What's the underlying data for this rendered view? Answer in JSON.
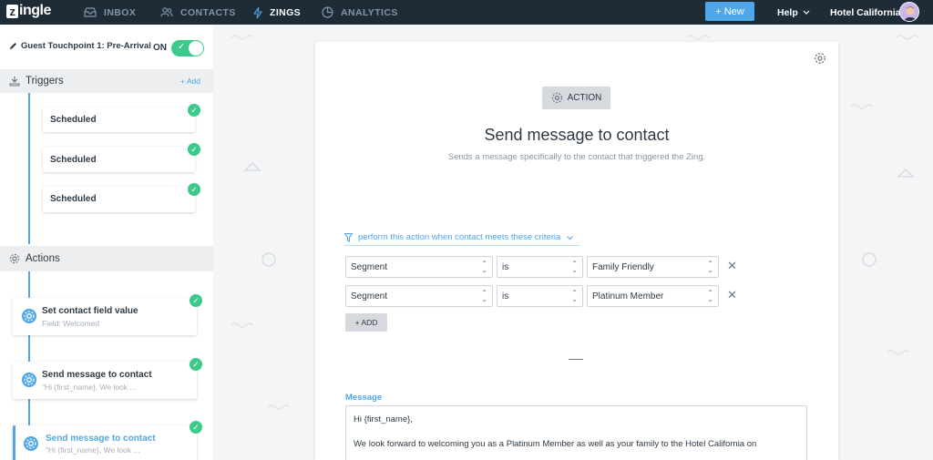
{
  "nav": {
    "logo": "ingle",
    "logo_mark": "z",
    "items": [
      {
        "label": "INBOX",
        "icon": "inbox-icon"
      },
      {
        "label": "CONTACTS",
        "icon": "contacts-icon"
      },
      {
        "label": "ZINGS",
        "icon": "lightning-icon"
      },
      {
        "label": "ANALYTICS",
        "icon": "pie-chart-icon"
      }
    ],
    "new_button": "+ New",
    "help": "Help",
    "account": "Hotel California"
  },
  "sidebar": {
    "zing_name": "Guest Touchpoint 1: Pre-Arrival",
    "toggle_label": "ON",
    "triggers": {
      "title": "Triggers",
      "add_label": "+ Add",
      "items": [
        {
          "label": "Scheduled"
        },
        {
          "label": "Scheduled"
        },
        {
          "label": "Scheduled"
        }
      ]
    },
    "actions": {
      "title": "Actions",
      "items": [
        {
          "label": "Set contact field value",
          "sub": "Field: Welcomed"
        },
        {
          "label": "Send message to contact",
          "sub": "\"Hi {first_name}, We look ..."
        },
        {
          "label": "Send message to contact",
          "sub": "\"Hi {first_name}, We look ..."
        }
      ]
    }
  },
  "panel": {
    "badge": "ACTION",
    "title": "Send message to contact",
    "subtitle": "Sends a message specifically to the contact that triggered the Zing.",
    "criteria_label": "perform this action when contact meets these criteria",
    "rules": [
      {
        "field": "Segment",
        "operator": "is",
        "value": "Family Friendly"
      },
      {
        "field": "Segment",
        "operator": "is",
        "value": "Platinum Member"
      }
    ],
    "add_rule_label": "+ ADD",
    "message_label": "Message",
    "message_lines": [
      "Hi {first_name},",
      "We look forward to welcoming you as a Platinum Member as well as your family to the Hotel California on"
    ]
  },
  "colors": {
    "nav_bg": "#1e2c38",
    "accent": "#4fa7e8",
    "success": "#3cc98a"
  }
}
